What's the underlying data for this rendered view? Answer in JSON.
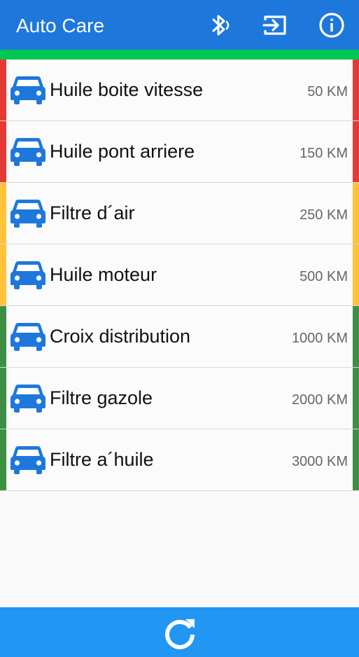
{
  "app": {
    "title": "Auto Care",
    "colors": {
      "appbar": "#1e78dc",
      "bottombar": "#2196f3",
      "strip": "#00c853",
      "car": "#1e78dc"
    },
    "icons": {
      "bluetooth": "bluetooth-icon",
      "exit": "exit-icon",
      "info": "info-icon",
      "refresh": "refresh-icon"
    }
  },
  "items": [
    {
      "label": "Huile boite vitesse",
      "distance": "50 KM",
      "status_color": "#e53935"
    },
    {
      "label": "Huile pont arriere",
      "distance": "150 KM",
      "status_color": "#e53935"
    },
    {
      "label": "Filtre d´air",
      "distance": "250 KM",
      "status_color": "#ffc33a"
    },
    {
      "label": "Huile moteur",
      "distance": "500 KM",
      "status_color": "#ffc33a"
    },
    {
      "label": "Croix distribution",
      "distance": "1000 KM",
      "status_color": "#3d8f44"
    },
    {
      "label": "Filtre gazole",
      "distance": "2000 KM",
      "status_color": "#3d8f44"
    },
    {
      "label": "Filtre a´huile",
      "distance": "3000 KM",
      "status_color": "#3d8f44"
    }
  ]
}
